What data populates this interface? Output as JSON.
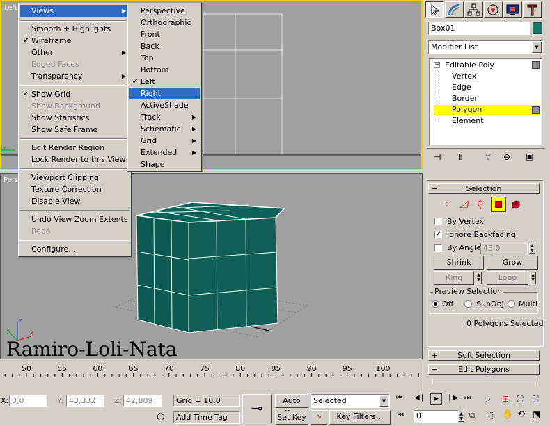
{
  "viewports": {
    "left": {
      "label": "Left"
    },
    "perspective": {
      "label": "Pers",
      "watermark": "Ramiro-Loli-Nata"
    }
  },
  "main_menu": {
    "items": [
      {
        "label": "Views",
        "submenu": true,
        "highlighted": true
      },
      {
        "label": "Smooth + Highlights"
      },
      {
        "label": "Wireframe",
        "checked": true
      },
      {
        "label": "Other",
        "submenu": true
      },
      {
        "label": "Edged Faces",
        "disabled": true
      },
      {
        "label": "Transparency",
        "submenu": true
      },
      {
        "label": "Show Grid",
        "checked": true
      },
      {
        "label": "Show Background",
        "disabled": true
      },
      {
        "label": "Show Statistics"
      },
      {
        "label": "Show Safe Frame"
      },
      {
        "label": "Edit Render Region"
      },
      {
        "label": "Lock Render to this View"
      },
      {
        "label": "Viewport Clipping"
      },
      {
        "label": "Texture Correction"
      },
      {
        "label": "Disable View"
      },
      {
        "label": "Undo View Zoom Extents"
      },
      {
        "label": "Redo",
        "disabled": true
      },
      {
        "label": "Configure..."
      }
    ]
  },
  "views_submenu": {
    "items": [
      {
        "label": "Perspective"
      },
      {
        "label": "Orthographic"
      },
      {
        "label": "Front"
      },
      {
        "label": "Back"
      },
      {
        "label": "Top"
      },
      {
        "label": "Bottom"
      },
      {
        "label": "Left",
        "checked": true
      },
      {
        "label": "Right",
        "highlighted": true
      },
      {
        "label": "ActiveShade"
      },
      {
        "label": "Track",
        "submenu": true
      },
      {
        "label": "Schematic",
        "submenu": true
      },
      {
        "label": "Grid",
        "submenu": true
      },
      {
        "label": "Extended",
        "submenu": true
      },
      {
        "label": "Shape"
      }
    ]
  },
  "command_panel": {
    "tabs": [
      "create-icon",
      "modify-icon",
      "hierarchy-icon",
      "motion-icon",
      "display-icon",
      "utilities-icon"
    ],
    "object_name": "Box01",
    "object_color": "#0f7a66",
    "modifier_list": "Modifier List",
    "stack": {
      "root": "Editable Poly",
      "children": [
        "Vertex",
        "Edge",
        "Border",
        "Polygon",
        "Element"
      ],
      "selected": "Polygon"
    }
  },
  "selection_rollout": {
    "title": "Selection",
    "by_vertex": "By Vertex",
    "ignore_backfacing": "Ignore Backfacing",
    "by_angle": "By Angle:",
    "angle_value": "45,0",
    "shrink": "Shrink",
    "grow": "Grow",
    "ring": "Ring",
    "loop": "Loop",
    "preview_selection": "Preview Selection",
    "preview_off": "Off",
    "preview_subobj": "SubObj",
    "preview_multi": "Multi",
    "selected_count": "0 Polygons Selected"
  },
  "soft_selection": {
    "title": "Soft Selection"
  },
  "edit_polygons": {
    "title": "Edit Polygons"
  },
  "timeline": {
    "ticks": [
      "50",
      "55",
      "60",
      "65",
      "70",
      "75",
      "80",
      "85",
      "90",
      "95",
      "100"
    ]
  },
  "status_bar": {
    "x_label": "X:",
    "x_value": "0,0",
    "y_label": "Y:",
    "y_value": "43,332",
    "z_label": "Z:",
    "z_value": "42,809",
    "grid": "Grid = 10,0",
    "add_time_tag": "Add Time Tag",
    "auto_key": "Auto Key",
    "set_key": "Set Key",
    "selected": "Selected",
    "key_filters": "Key Filters...",
    "frame": "0"
  },
  "colors": {
    "highlight": "#316ac5",
    "active_border": "#f0d000",
    "stack_select": "#ffff00",
    "cube": "#0d5a52"
  }
}
